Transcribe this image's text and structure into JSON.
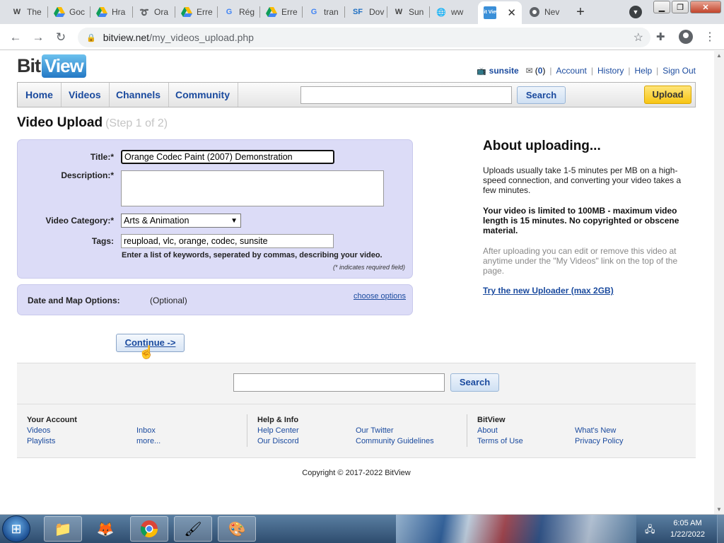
{
  "browser": {
    "tabs": [
      {
        "icon": "W",
        "label": "The"
      },
      {
        "icon": "drive",
        "label": "Goc"
      },
      {
        "icon": "drive",
        "label": "Hra"
      },
      {
        "icon": "swirl",
        "label": "Ora"
      },
      {
        "icon": "drive",
        "label": "Erre"
      },
      {
        "icon": "G",
        "label": "Rég"
      },
      {
        "icon": "drive",
        "label": "Erre"
      },
      {
        "icon": "G",
        "label": "tran"
      },
      {
        "icon": "SF",
        "label": "Dov"
      },
      {
        "icon": "W",
        "label": "Sun"
      },
      {
        "icon": "globe",
        "label": "ww"
      },
      {
        "icon": "Bit View",
        "label": ""
      },
      {
        "icon": "chrome",
        "label": "Nev"
      }
    ],
    "new_tab": "+",
    "url_domain": "bitview.net",
    "url_path": "/my_videos_upload.php"
  },
  "site": {
    "logo_bit": "Bit",
    "logo_view": "View",
    "user": {
      "username": "sunsite",
      "mail_count_open": "(",
      "mail_count": "0",
      "mail_count_close": ")",
      "links": [
        "Account",
        "History",
        "Help",
        "Sign Out"
      ]
    },
    "nav": {
      "home": "Home",
      "videos": "Videos",
      "channels": "Channels",
      "community": "Community",
      "search_button": "Search",
      "upload_button": "Upload"
    }
  },
  "page": {
    "title": "Video Upload",
    "step": "(Step 1 of 2)",
    "form": {
      "title_label": "Title:*",
      "title_value": "Orange Codec Paint (2007) Demonstration",
      "description_label": "Description:*",
      "description_value": "",
      "category_label": "Video Category:*",
      "category_value": "Arts & Animation",
      "tags_label": "Tags:",
      "tags_value": "reupload, vlc, orange, codec, sunsite",
      "tags_hint": "Enter a list of keywords, seperated by commas, describing your video.",
      "required_note": "(* indicates required field)"
    },
    "options": {
      "label": "Date and Map Options:",
      "optional": "(Optional)",
      "link": "choose options"
    },
    "continue_button": "Continue ->",
    "about": {
      "title": "About uploading...",
      "p1": "Uploads usually take 1-5 minutes per MB on a high-speed connection, and converting your video takes a few minutes.",
      "p2": "Your video is limited to 100MB - maximum video length is 15 minutes. No copyrighted or obscene material.",
      "p3": "After uploading you can edit or remove this video at anytime under the \"My Videos\" link on the top of the page.",
      "link": "Try the new Uploader (max 2GB)"
    }
  },
  "footer": {
    "search_button": "Search",
    "your_account": {
      "heading": "Your Account",
      "links": [
        "Videos",
        "Inbox",
        "Playlists",
        "more..."
      ]
    },
    "help_info": {
      "heading": "Help & Info",
      "links": [
        "Help Center",
        "Our Twitter",
        "Our Discord",
        "Community Guidelines"
      ]
    },
    "bitview": {
      "heading": "BitView",
      "links": [
        "About",
        "What's New",
        "Terms of Use",
        "Privacy Policy"
      ]
    },
    "copyright": "Copyright © 2017-2022 BitView"
  },
  "taskbar": {
    "time": "6:05 AM",
    "date": "1/22/2022"
  }
}
